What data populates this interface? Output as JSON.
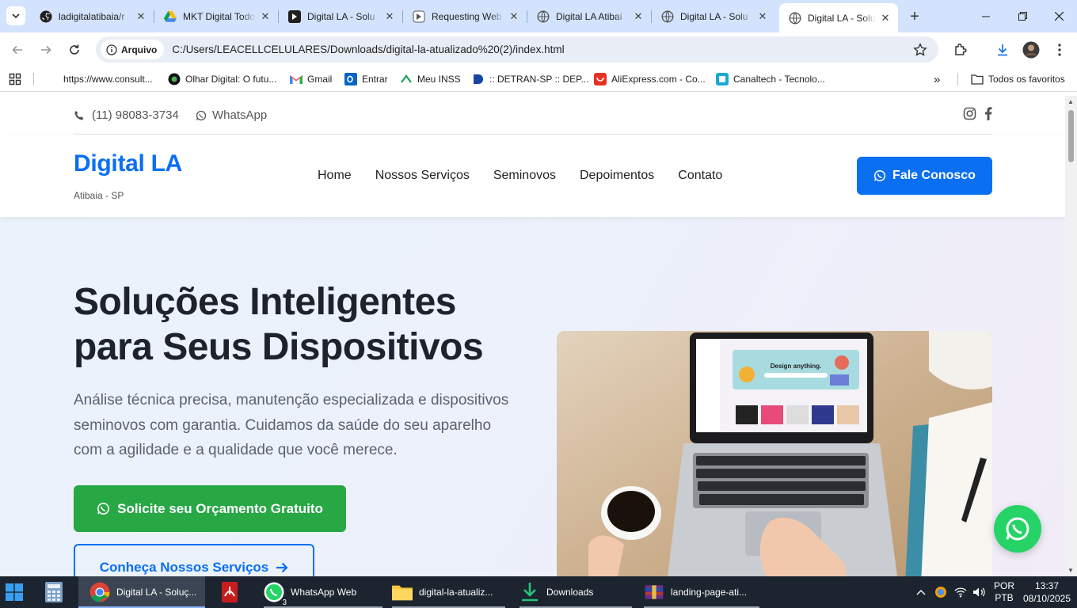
{
  "browser": {
    "tabs": [
      {
        "title": "ladigitalatibaia/r",
        "icon": "github-icon"
      },
      {
        "title": "MKT Digital Todo",
        "icon": "google-drive-icon"
      },
      {
        "title": "Digital LA - Solu",
        "icon": "app-icon"
      },
      {
        "title": "Requesting Web",
        "icon": "app-icon"
      },
      {
        "title": "Digital LA Atibai",
        "icon": "globe-icon"
      },
      {
        "title": "Digital LA - Solu",
        "icon": "globe-icon"
      },
      {
        "title": "Digital LA - Solu",
        "icon": "globe-icon",
        "active": true
      }
    ],
    "address": {
      "chip": "Arquivo",
      "url": "C:/Users/LEACELLCELULARES/Downloads/digital-la-atualizado%20(2)/index.html"
    },
    "bookmarks": [
      "https://www.consult...",
      "Olhar Digital: O futu...",
      "Gmail",
      "Entrar",
      "Meu INSS",
      ":: DETRAN-SP :: DEP...",
      "AliExpress.com - Co...",
      "Canaltech - Tecnolo..."
    ],
    "all_bookmarks": "Todos os favoritos"
  },
  "site": {
    "topbar": {
      "phone": "(11) 98083-3734",
      "whatsapp": "WhatsApp"
    },
    "logo": "Digital LA",
    "logo_sub": "Atibaia - SP",
    "nav": [
      "Home",
      "Nossos Serviços",
      "Seminovos",
      "Depoimentos",
      "Contato"
    ],
    "cta": "Fale Conosco",
    "hero": {
      "title_line1": "Soluções Inteligentes",
      "title_line2": "para Seus Dispositivos",
      "lead": "Análise técnica precisa, manutenção especializada e dispositivos seminovos com garantia. Cuidamos da saúde do seu aparelho com a agilidade e a qualidade que você merece.",
      "primary_button": "Solicite seu Orçamento Gratuito",
      "secondary_button": "Conheça Nossos Serviços",
      "screen_text": "Design anything."
    }
  },
  "taskbar": {
    "items": [
      "Digital LA - Soluç...",
      "WhatsApp Web",
      "digital-la-atualiz...",
      "Downloads",
      "landing-page-ati..."
    ],
    "whatsapp_badge": "3",
    "lang_top": "POR",
    "lang_bottom": "PTB",
    "time": "13:37",
    "date": "08/10/2025"
  },
  "colors": {
    "brand_blue": "#0b6ff2",
    "green": "#28a745",
    "whatsapp": "#25d366",
    "tabstrip": "#d3e3fd"
  }
}
